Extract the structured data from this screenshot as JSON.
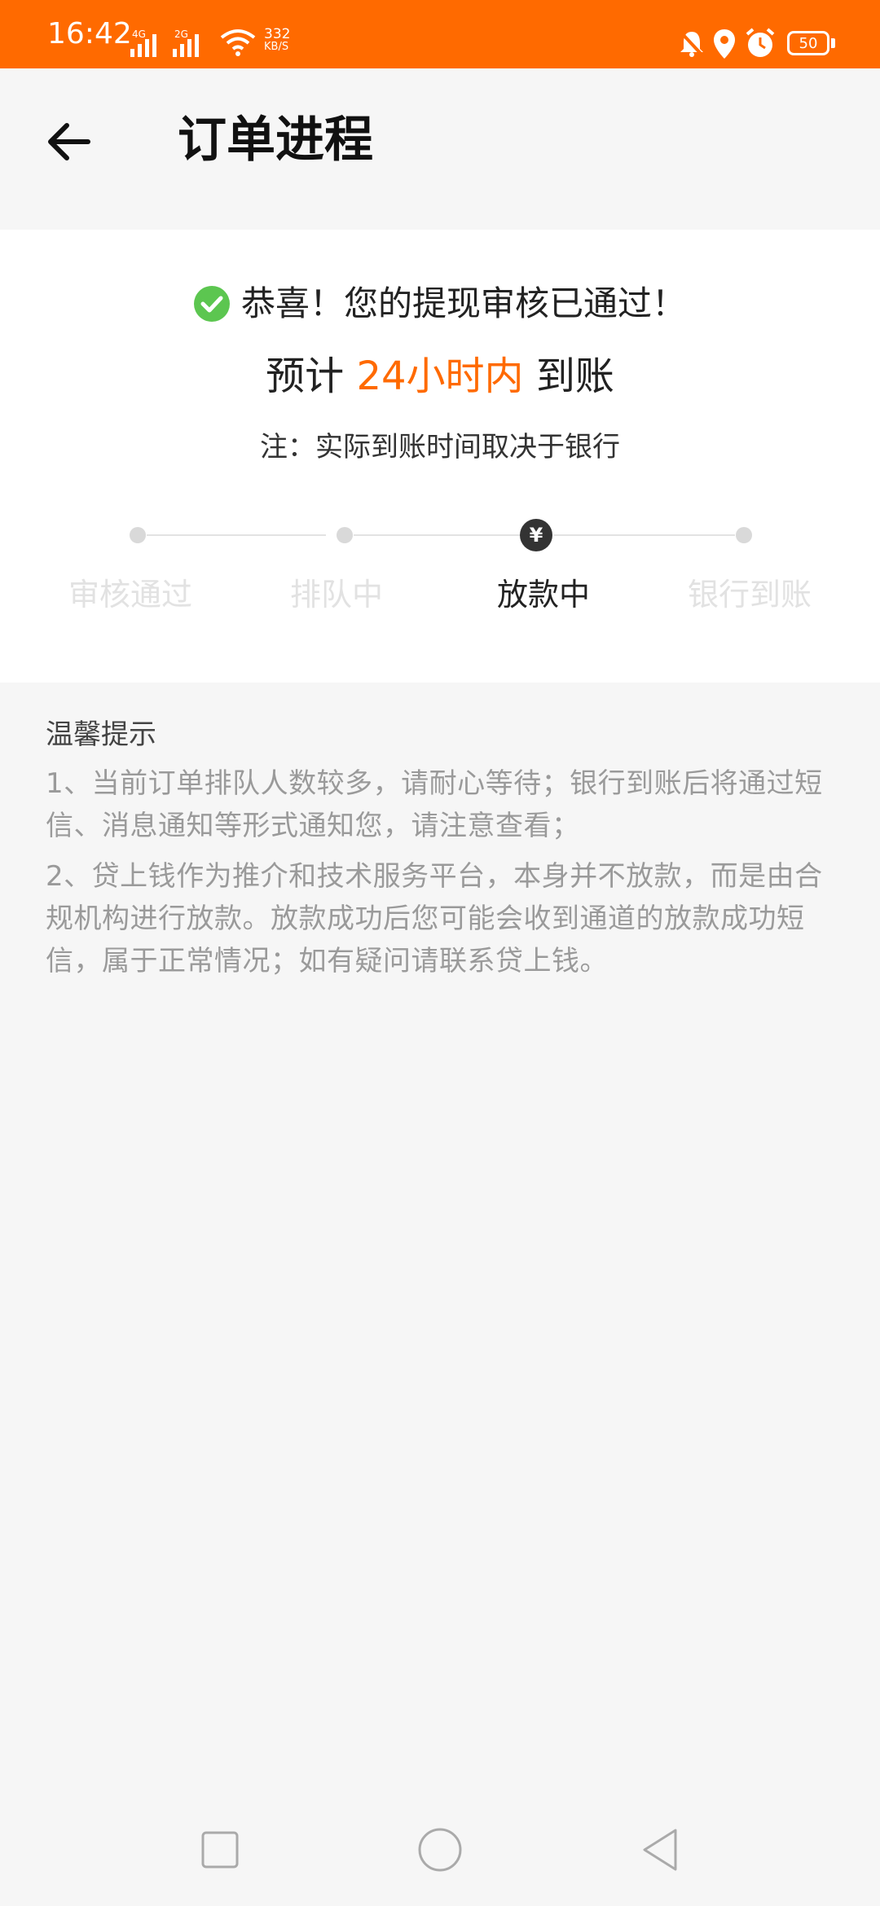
{
  "status_bar": {
    "time": "16:42",
    "signal_1": "4G",
    "signal_2": "2G",
    "net_speed_value": "332",
    "net_speed_unit": "KB/S",
    "battery": "50",
    "icons": [
      "mute-bell-icon",
      "location-icon",
      "alarm-icon",
      "battery-icon"
    ]
  },
  "header": {
    "title": "订单进程"
  },
  "result": {
    "success_text": "恭喜！您的提现审核已通过！",
    "eta_prefix": "预计",
    "eta_highlight": "24小时内",
    "eta_suffix": "到账",
    "note": "注：实际到账时间取决于银行"
  },
  "steps": [
    {
      "label": "审核通过",
      "active": false
    },
    {
      "label": "排队中",
      "active": false
    },
    {
      "label": "放款中",
      "active": true,
      "icon_glyph": "¥"
    },
    {
      "label": "银行到账",
      "active": false
    }
  ],
  "tips": {
    "title": "温馨提示",
    "items": [
      "1、当前订单排队人数较多，请耐心等待；银行到账后将通过短信、消息通知等形式通知您，请注意查看；",
      "2、贷上钱作为推介和技术服务平台，本身并不放款，而是由合规机构进行放款。放款成功后您可能会收到通道的放款成功短信，属于正常情况；如有疑问请联系贷上钱。"
    ]
  },
  "colors": {
    "accent": "#ff6a00",
    "success": "#5cc650",
    "active_step": "#333333",
    "inactive_text": "#e2e2e2",
    "tip_text": "#9a9a9a"
  }
}
